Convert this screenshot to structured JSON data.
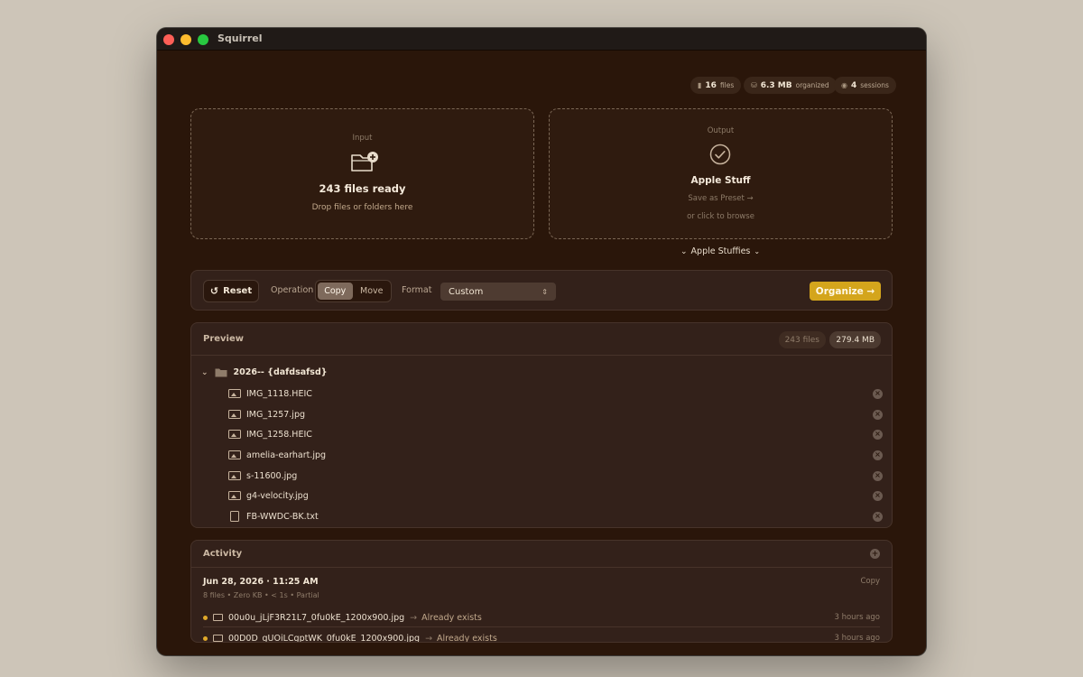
{
  "window": {
    "title": "Squirrel"
  },
  "stats": [
    {
      "value": "16",
      "label": "files",
      "icon": "document-icon"
    },
    {
      "value": "6.3 MB",
      "label": "organized",
      "icon": "drive-icon"
    },
    {
      "value": "4",
      "label": "sessions",
      "icon": "clock-icon"
    }
  ],
  "input": {
    "caption": "Input",
    "status": "243 files ready",
    "hint": "Drop files or folders here"
  },
  "output": {
    "caption": "Output",
    "name": "Apple Stuff",
    "save_preset": "Save as Preset →",
    "browse": "or click to browse"
  },
  "preset_selector": {
    "label": "Apple Stuffies"
  },
  "toolbar": {
    "reset_label": "Reset",
    "operation_label": "Operation",
    "operations": [
      "Copy",
      "Move"
    ],
    "selected_operation": "Copy",
    "format_label": "Format",
    "format_value": "Custom",
    "organize_label": "Organize →"
  },
  "preview": {
    "title": "Preview",
    "file_count": "243 files",
    "size": "279.4 MB",
    "folder": "2026-- {dafdsafsd}",
    "files": [
      {
        "name": "IMG_1118.HEIC",
        "type": "image"
      },
      {
        "name": "IMG_1257.jpg",
        "type": "image"
      },
      {
        "name": "IMG_1258.HEIC",
        "type": "image"
      },
      {
        "name": "amelia-earhart.jpg",
        "type": "image"
      },
      {
        "name": "s-11600.jpg",
        "type": "image"
      },
      {
        "name": "g4-velocity.jpg",
        "type": "image"
      },
      {
        "name": "FB-WWDC-BK.txt",
        "type": "text"
      }
    ]
  },
  "activity": {
    "title": "Activity",
    "session": {
      "date": "Jun 28, 2026 · 11:25 AM",
      "operation": "Copy",
      "meta": "8 files • Zero KB • < 1s • Partial"
    },
    "rows": [
      {
        "file": "00u0u_jLjF3R21L7_0fu0kE_1200x900.jpg",
        "status": "Already exists",
        "ago": "3 hours ago"
      },
      {
        "file": "00D0D_gUOiLCgptWK_0fu0kE_1200x900.jpg",
        "status": "Already exists",
        "ago": "3 hours ago"
      }
    ]
  },
  "colors": {
    "background": "#2a160a",
    "accent": "#d4a51c",
    "status_dot": "#e0a92a"
  }
}
